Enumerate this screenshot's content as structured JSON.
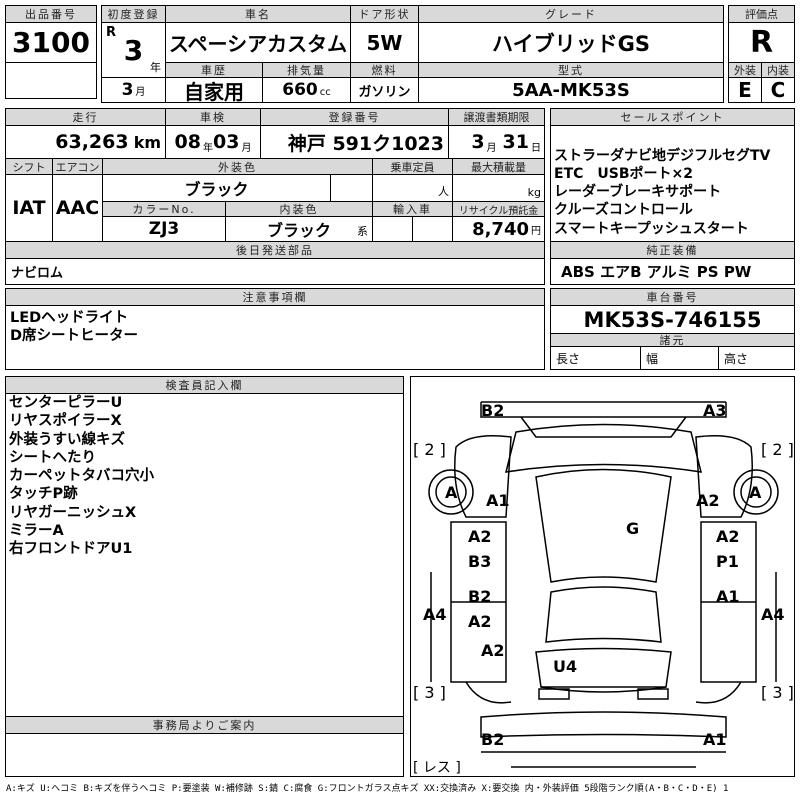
{
  "lot": {
    "label": "出品番号",
    "value": "3100"
  },
  "first_reg": {
    "label": "初度登録",
    "era": "R",
    "year": "3",
    "year_unit": "年",
    "month": "3",
    "month_unit": "月"
  },
  "car_name": {
    "label": "車名",
    "value": "スペーシアカスタム"
  },
  "door": {
    "label": "ドア形状",
    "value": "5W"
  },
  "grade": {
    "label": "グレード",
    "value": "ハイブリッドGS"
  },
  "history": {
    "label": "車歴",
    "value": "自家用"
  },
  "displacement": {
    "label": "排気量",
    "value": "660",
    "unit": "cc"
  },
  "fuel": {
    "label": "燃料",
    "value": "ガソリン"
  },
  "model": {
    "label": "型式",
    "value": "5AA-MK53S"
  },
  "score": {
    "label": "評価点",
    "value": "R",
    "ext_label": "外装",
    "int_label": "内装",
    "ext": "E",
    "int": "C"
  },
  "mileage": {
    "label": "走行",
    "value": "63,263",
    "unit": "km"
  },
  "inspection": {
    "label": "車検",
    "year": "08",
    "year_unit": "年",
    "month": "03",
    "month_unit": "月"
  },
  "plate": {
    "label": "登録番号",
    "value": "神戸 591ク1023"
  },
  "transfer": {
    "label": "譲渡書類期限",
    "month": "3",
    "month_unit": "月",
    "day": "31",
    "day_unit": "日"
  },
  "shift": {
    "label": "シフト",
    "value": "IAT"
  },
  "ac": {
    "label": "エアコン",
    "value": "AAC"
  },
  "ext_color": {
    "label": "外装色",
    "value": "ブラック"
  },
  "capacity": {
    "label": "乗車定員",
    "unit": "人"
  },
  "max_load": {
    "label": "最大積載量",
    "unit": "kg"
  },
  "color_no": {
    "label": "カラーNo.",
    "value": "ZJ3"
  },
  "int_color": {
    "label": "内装色",
    "value": "ブラック",
    "suffix": "系"
  },
  "import": {
    "label": "輸入車"
  },
  "recycle": {
    "label": "リサイクル預託金",
    "value": "8,740",
    "unit": "円"
  },
  "later_parts": {
    "label": "後日発送部品",
    "value": "ナビロム"
  },
  "sales_points": {
    "label": "セールスポイント",
    "items": [
      "ストラーダナビ地デジフルセグTV",
      "ETC　USBポート×2",
      "レーダーブレーキサポート",
      "クルーズコントロール",
      "スマートキープッシュスタート"
    ]
  },
  "equipment": {
    "label": "純正装備",
    "value": "ABS エアB アルミ PS PW"
  },
  "notes": {
    "label": "注意事項欄",
    "items": [
      "LEDヘッドライト",
      "D席シートヒーター"
    ]
  },
  "chassis": {
    "label": "車台番号",
    "value": "MK53S-746155"
  },
  "specs": {
    "label": "諸元",
    "length": "長さ",
    "width": "幅",
    "height": "高さ"
  },
  "inspector": {
    "label": "検査員記入欄",
    "items": [
      "センターピラーU",
      "リヤスポイラーX",
      "外装うすい線キズ",
      "シートへたり",
      "カーペットタバコ穴小",
      "タッチP跡",
      "リヤガーニッシュX",
      "ミラーA",
      "右フロントドアU1"
    ]
  },
  "office": {
    "label": "事務局よりご案内"
  },
  "diagram": {
    "marks": [
      "B2",
      "A3",
      "[ 2 ]",
      "[ 2 ]",
      "A",
      "A",
      "A1",
      "A2",
      "G",
      "A2",
      "B3",
      "A2",
      "P1",
      "B2",
      "A2",
      "A1",
      "A4",
      "A4",
      "A2",
      "U4",
      "[ 3 ]",
      "[ 3 ]",
      "B2",
      "A1",
      "[ レス ]"
    ]
  },
  "legend": "A:キズ U:ヘコミ B:キズを伴うヘコミ P:要塗装 W:補修跡 S:錆 C:腐食 G:フロントガラス点キズ XX:交換済み X:要交換 内・外装評価 5段階ランク順(A・B・C・D・E) 1"
}
